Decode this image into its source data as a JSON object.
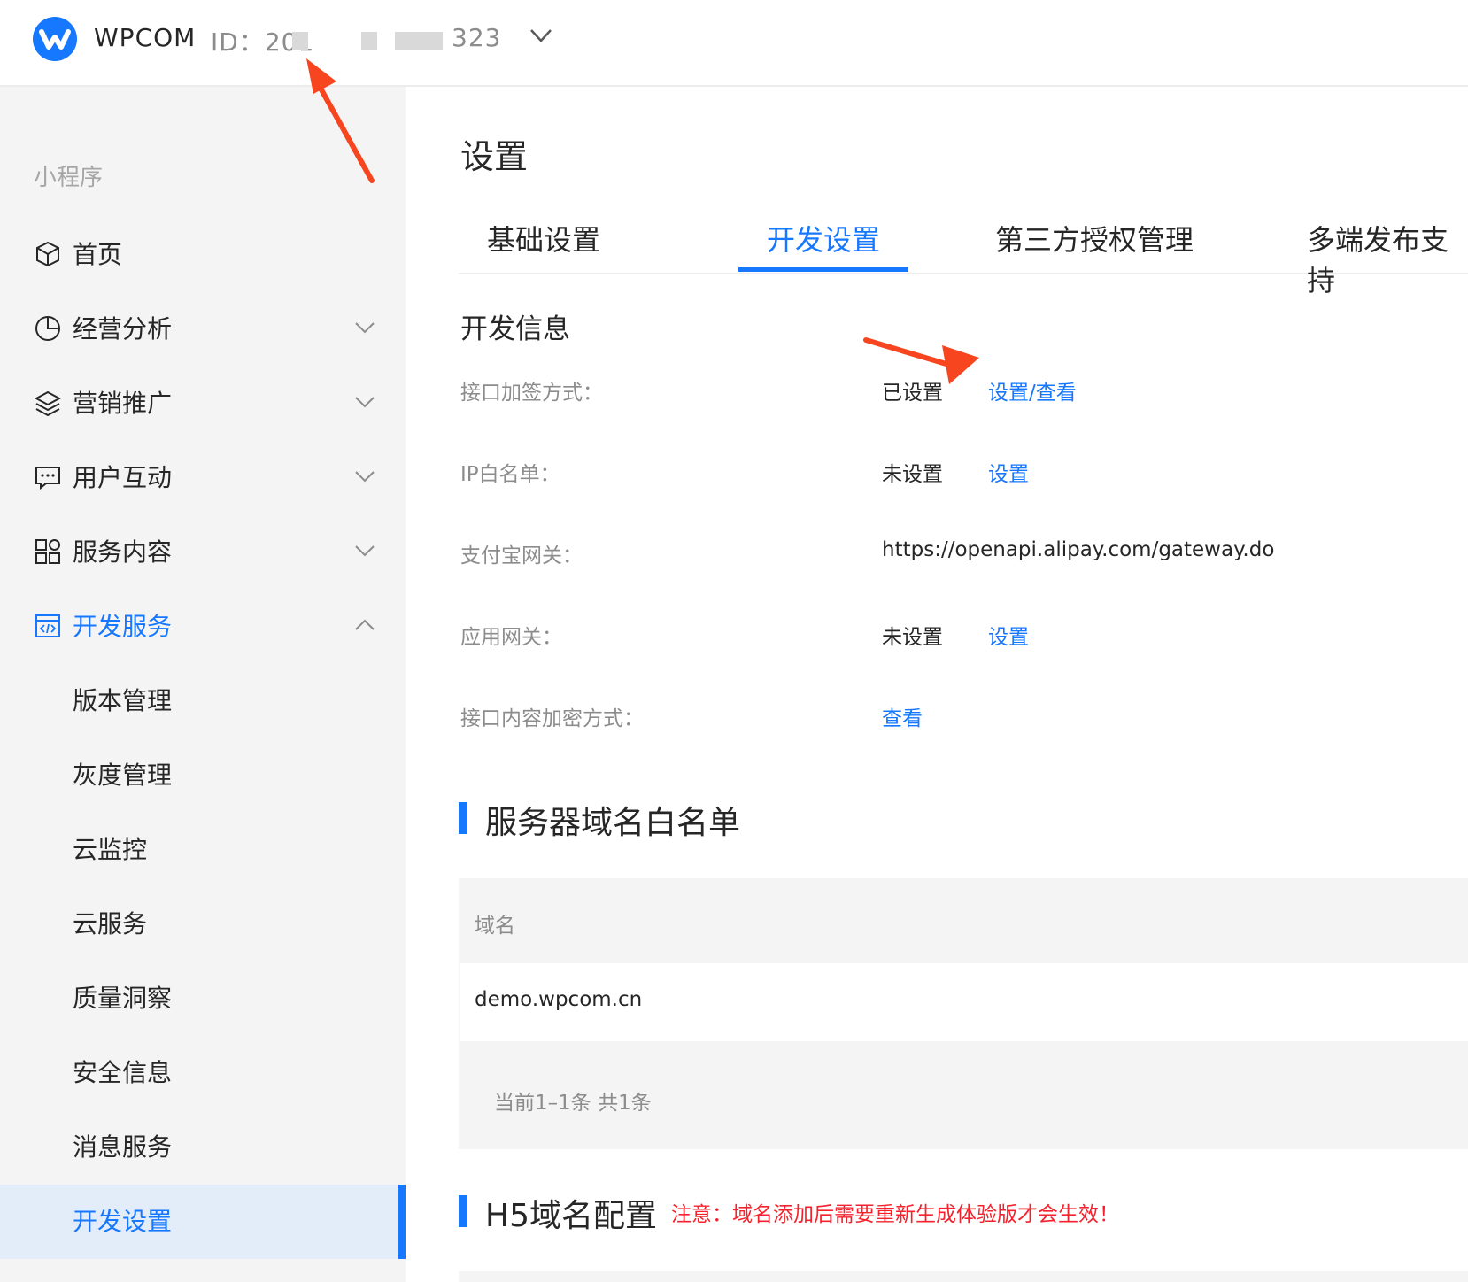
{
  "colors": {
    "accent": "#1677ff",
    "annotation_arrow": "#f6451f",
    "warning": "#f5222d"
  },
  "topbar": {
    "brand": "WPCOM",
    "account_id_prefix": "ID：201",
    "account_id_suffix": "323",
    "logo_icon": "wpcom-logo-icon",
    "dropdown_icon": "chevron-down-icon"
  },
  "sidebar": {
    "section_title": "小程序",
    "items": [
      {
        "label": "首页",
        "icon": "cube-icon"
      },
      {
        "label": "经营分析",
        "icon": "pie-chart-icon"
      },
      {
        "label": "营销推广",
        "icon": "layers-icon"
      },
      {
        "label": "用户互动",
        "icon": "message-icon"
      },
      {
        "label": "服务内容",
        "icon": "apps-icon"
      },
      {
        "label": "开发服务",
        "icon": "code-window-icon"
      }
    ],
    "sub_items": [
      {
        "label": "版本管理"
      },
      {
        "label": "灰度管理"
      },
      {
        "label": "云监控"
      },
      {
        "label": "云服务"
      },
      {
        "label": "质量洞察"
      },
      {
        "label": "安全信息"
      },
      {
        "label": "消息服务"
      },
      {
        "label": "开发设置"
      }
    ]
  },
  "main": {
    "title": "设置",
    "tabs": [
      {
        "label": "基础设置"
      },
      {
        "label": "开发设置"
      },
      {
        "label": "第三方授权管理"
      },
      {
        "label": "多端发布支持"
      }
    ],
    "dev_info": {
      "heading": "开发信息",
      "rows": [
        {
          "label": "接口加签方式：",
          "value": "已设置",
          "link": "设置/查看"
        },
        {
          "label": "IP白名单：",
          "value": "未设置",
          "link": "设置"
        },
        {
          "label": "支付宝网关：",
          "value": "https://openapi.alipay.com/gateway.do"
        },
        {
          "label": "应用网关：",
          "value": "未设置",
          "link": "设置"
        },
        {
          "label": "接口内容加密方式：",
          "link": "查看"
        }
      ]
    },
    "server_whitelist": {
      "title": "服务器域名白名单",
      "column_header": "域名",
      "rows": [
        "demo.wpcom.cn"
      ],
      "pagination": "当前1–1条 共1条"
    },
    "h5": {
      "title": "H5域名配置",
      "notice": "注意：域名添加后需要重新生成体验版才会生效！"
    }
  }
}
